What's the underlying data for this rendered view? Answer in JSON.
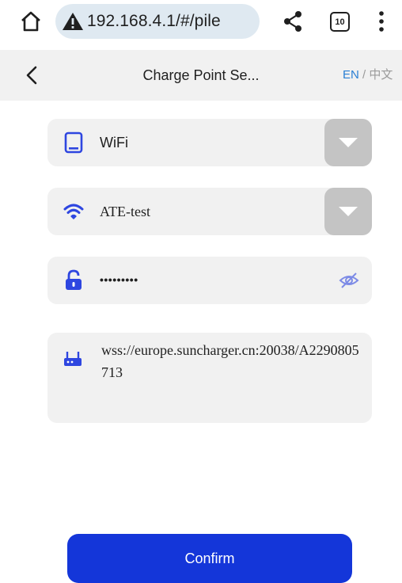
{
  "browser": {
    "url": "192.168.4.1/#/pile",
    "tab_count": "10"
  },
  "header": {
    "title": "Charge Point Se...",
    "lang_en": "EN",
    "lang_sep": " / ",
    "lang_zh": "中文"
  },
  "form": {
    "network_type": "WiFi",
    "ssid": "ATE-test",
    "password_masked": "•••••••••",
    "server_url": "wss://europe.suncharger.cn:20038/A2290805713"
  },
  "actions": {
    "confirm_label": "Confirm"
  },
  "colors": {
    "accent": "#1436d9",
    "icon_blue": "#2e46e0",
    "field_bg": "#f1f1f1",
    "dropdown_bg": "#c4c4c4",
    "lang_active": "#2a7fd4"
  }
}
